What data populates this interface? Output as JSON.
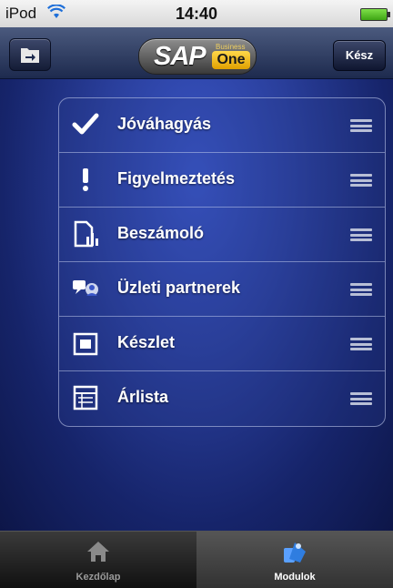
{
  "status_bar": {
    "carrier": "iPod",
    "time": "14:40"
  },
  "nav_bar": {
    "left_button_icon": "folder-arrow-icon",
    "logo": {
      "sap": "SAP",
      "business": "Business",
      "one": "One"
    },
    "done_label": "Kész"
  },
  "modules": [
    {
      "label": "Jóváhagyás",
      "icon": "checkmark-icon"
    },
    {
      "label": "Figyelmeztetés",
      "icon": "exclamation-icon"
    },
    {
      "label": "Beszámoló",
      "icon": "report-icon"
    },
    {
      "label": "Üzleti partnerek",
      "icon": "business-partners-icon"
    },
    {
      "label": "Készlet",
      "icon": "inventory-icon"
    },
    {
      "label": "Árlista",
      "icon": "price-list-icon"
    }
  ],
  "tab_bar": {
    "tabs": [
      {
        "label": "Kezdőlap",
        "icon": "home-icon",
        "selected": false
      },
      {
        "label": "Modulok",
        "icon": "modules-icon",
        "selected": true
      }
    ]
  },
  "colors": {
    "accent_one": "#ffd84a",
    "background": "#2a3f9c"
  }
}
